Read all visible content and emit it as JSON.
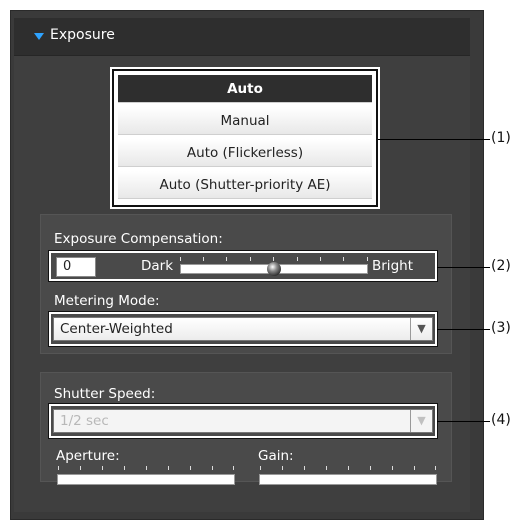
{
  "panel": {
    "title": "Exposure"
  },
  "exposure_modes": {
    "items": [
      "Auto",
      "Manual",
      "Auto (Flickerless)",
      "Auto (Shutter-priority AE)"
    ],
    "selected": "Auto"
  },
  "exposure_compensation": {
    "label": "Exposure Compensation:",
    "value": "0",
    "dark_label": "Dark",
    "bright_label": "Bright"
  },
  "metering_mode": {
    "label": "Metering Mode:",
    "value": "Center-Weighted"
  },
  "shutter_speed": {
    "label": "Shutter Speed:",
    "value": "1/2 sec",
    "disabled": true
  },
  "aperture": {
    "label": "Aperture:"
  },
  "gain": {
    "label": "Gain:"
  },
  "callouts": [
    "(1)",
    "(2)",
    "(3)",
    "(4)"
  ],
  "colors": {
    "accent": "#2ea3ff",
    "panel_bg": "#3a3a3a",
    "selected_bg": "#2e2e2e"
  }
}
